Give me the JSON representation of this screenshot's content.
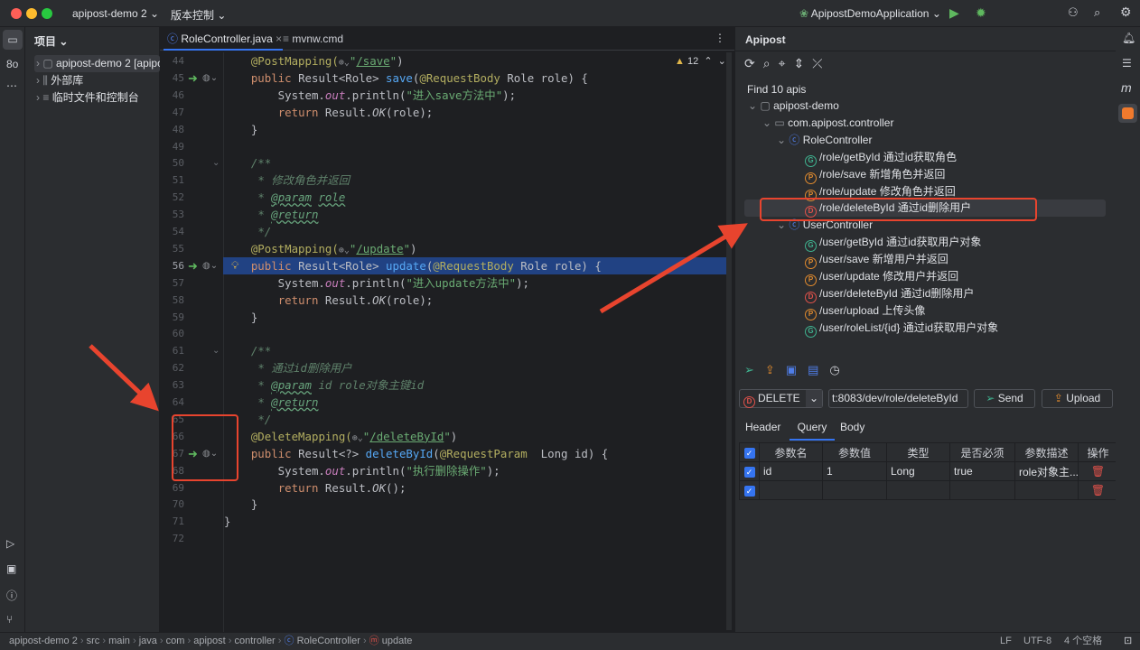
{
  "titlebar": {
    "project": "apipost-demo 2",
    "vcs": "版本控制",
    "run_config": "ApipostDemoApplication"
  },
  "project_panel": {
    "title": "项目",
    "items": [
      {
        "label": "apipost-demo 2 [apipost-demo]",
        "icon": "module-folder-icon"
      },
      {
        "label": "外部库",
        "icon": "library-icon"
      },
      {
        "label": "临时文件和控制台",
        "icon": "scratch-icon"
      }
    ]
  },
  "editor": {
    "tabs": [
      {
        "label": "RoleController.java",
        "active": true
      },
      {
        "label": "mvnw.cmd",
        "active": false
      }
    ],
    "warnings": "12",
    "current_line": 56,
    "lines": [
      {
        "n": 44,
        "t": [
          [
            "    "
          ],
          [
            "@PostMapping(",
            "ann"
          ],
          [
            "⊕⌄",
            "glob"
          ],
          [
            "\"",
            "str"
          ],
          [
            "/save",
            "lnk"
          ],
          [
            "\"",
            "str"
          ],
          [
            ")"
          ]
        ]
      },
      {
        "n": 45,
        "g": true,
        "t": [
          [
            "    "
          ],
          [
            "public ",
            "kw"
          ],
          [
            "Result<Role> "
          ],
          [
            "save",
            "fn"
          ],
          [
            "("
          ],
          [
            "@RequestBody",
            "ann"
          ],
          [
            " Role role) {"
          ]
        ]
      },
      {
        "n": 46,
        "t": [
          [
            "        System."
          ],
          [
            "out",
            "fld"
          ],
          [
            ".println("
          ],
          [
            "\"进入save方法中\"",
            "str"
          ],
          [
            ");"
          ]
        ]
      },
      {
        "n": 47,
        "t": [
          [
            "        "
          ],
          [
            "return ",
            "kw"
          ],
          [
            "Result."
          ],
          [
            "OK",
            "it"
          ],
          [
            "(role);"
          ]
        ]
      },
      {
        "n": 48,
        "t": [
          [
            "    }"
          ]
        ]
      },
      {
        "n": 49,
        "t": []
      },
      {
        "n": 50,
        "f": true,
        "t": [
          [
            "    "
          ],
          [
            "/**",
            "doc"
          ]
        ]
      },
      {
        "n": 51,
        "t": [
          [
            "     "
          ],
          [
            "* 修改角色并返回",
            "doc"
          ]
        ]
      },
      {
        "n": 52,
        "t": [
          [
            "     "
          ],
          [
            "* ",
            "doc"
          ],
          [
            "@param",
            "doctag"
          ],
          [
            " ",
            "doc"
          ],
          [
            "role",
            "doctag"
          ]
        ]
      },
      {
        "n": 53,
        "t": [
          [
            "     "
          ],
          [
            "* ",
            "doc"
          ],
          [
            "@return",
            "doctag"
          ]
        ]
      },
      {
        "n": 54,
        "t": [
          [
            "     "
          ],
          [
            "*/",
            "doc"
          ]
        ]
      },
      {
        "n": 55,
        "t": [
          [
            "    "
          ],
          [
            "@PostMapping(",
            "ann"
          ],
          [
            "⊕⌄",
            "glob"
          ],
          [
            "\"",
            "str"
          ],
          [
            "/update",
            "lnk"
          ],
          [
            "\"",
            "str"
          ],
          [
            ")"
          ]
        ]
      },
      {
        "n": 56,
        "g": true,
        "t": [
          [
            "    "
          ],
          [
            "public ",
            "kw"
          ],
          [
            "Result<Role> "
          ],
          [
            "update",
            "fn"
          ],
          [
            "("
          ],
          [
            "@RequestBody",
            "ann"
          ],
          [
            " Role role) {"
          ]
        ]
      },
      {
        "n": 57,
        "t": [
          [
            "        System."
          ],
          [
            "out",
            "fld"
          ],
          [
            ".println("
          ],
          [
            "\"进入update方法中\"",
            "str"
          ],
          [
            ");"
          ]
        ]
      },
      {
        "n": 58,
        "t": [
          [
            "        "
          ],
          [
            "return ",
            "kw"
          ],
          [
            "Result."
          ],
          [
            "OK",
            "it"
          ],
          [
            "(role);"
          ]
        ]
      },
      {
        "n": 59,
        "t": [
          [
            "    }"
          ]
        ]
      },
      {
        "n": 60,
        "t": []
      },
      {
        "n": 61,
        "f": true,
        "t": [
          [
            "    "
          ],
          [
            "/**",
            "doc"
          ]
        ]
      },
      {
        "n": 62,
        "t": [
          [
            "     "
          ],
          [
            "* 通过id删除用户",
            "doc"
          ]
        ]
      },
      {
        "n": 63,
        "t": [
          [
            "     "
          ],
          [
            "* ",
            "doc"
          ],
          [
            "@param",
            "doctag"
          ],
          [
            " id ",
            "doc"
          ],
          [
            "role对象主键id",
            "doc"
          ]
        ]
      },
      {
        "n": 64,
        "t": [
          [
            "     "
          ],
          [
            "* ",
            "doc"
          ],
          [
            "@return",
            "doctag"
          ]
        ]
      },
      {
        "n": 65,
        "t": [
          [
            "     "
          ],
          [
            "*/",
            "doc"
          ]
        ]
      },
      {
        "n": 66,
        "t": [
          [
            "    "
          ],
          [
            "@DeleteMapping(",
            "ann"
          ],
          [
            "⊕⌄",
            "glob"
          ],
          [
            "\"",
            "str"
          ],
          [
            "/deleteById",
            "lnk"
          ],
          [
            "\"",
            "str"
          ],
          [
            ")"
          ]
        ]
      },
      {
        "n": 67,
        "g": true,
        "t": [
          [
            "    "
          ],
          [
            "public ",
            "kw"
          ],
          [
            "Result<?> "
          ],
          [
            "deleteById",
            "fn"
          ],
          [
            "("
          ],
          [
            "@RequestParam",
            "ann"
          ],
          [
            "  Long id) {"
          ]
        ]
      },
      {
        "n": 68,
        "t": [
          [
            "        System."
          ],
          [
            "out",
            "fld"
          ],
          [
            ".println("
          ],
          [
            "\"执行删除操作\"",
            "str"
          ],
          [
            ");"
          ]
        ]
      },
      {
        "n": 69,
        "t": [
          [
            "        "
          ],
          [
            "return ",
            "kw"
          ],
          [
            "Result."
          ],
          [
            "OK",
            "it"
          ],
          [
            "();"
          ]
        ]
      },
      {
        "n": 70,
        "t": [
          [
            "    }"
          ]
        ]
      },
      {
        "n": 71,
        "t": [
          [
            "}"
          ]
        ]
      },
      {
        "n": 72,
        "t": []
      }
    ]
  },
  "apipost": {
    "title": "Apipost",
    "find_text": "Find 10 apis",
    "tree": [
      {
        "label": "apipost-demo",
        "level": 0,
        "kind": "module"
      },
      {
        "label": "com.apipost.controller",
        "level": 1,
        "kind": "package"
      },
      {
        "label": "RoleController",
        "level": 2,
        "kind": "class"
      },
      {
        "path": "/role/getById",
        "desc": "通过id获取角色",
        "method": "G"
      },
      {
        "path": "/role/save",
        "desc": "新增角色并返回",
        "method": "P"
      },
      {
        "path": "/role/update",
        "desc": "修改角色并返回",
        "method": "P"
      },
      {
        "path": "/role/deleteById",
        "desc": "通过id删除用户",
        "method": "D",
        "selected": true
      },
      {
        "label": "UserController",
        "level": 2,
        "kind": "class"
      },
      {
        "path": "/user/getById",
        "desc": "通过id获取用户对象",
        "method": "G"
      },
      {
        "path": "/user/save",
        "desc": "新增用户并返回",
        "method": "P"
      },
      {
        "path": "/user/update",
        "desc": "修改用户并返回",
        "method": "P"
      },
      {
        "path": "/user/deleteById",
        "desc": "通过id删除用户",
        "method": "D"
      },
      {
        "path": "/user/upload",
        "desc": "上传头像",
        "method": "P"
      },
      {
        "path": "/user/roleList/{id}",
        "desc": "通过id获取用户对象",
        "method": "G"
      }
    ],
    "method": "DELETE",
    "url": "t:8083/dev/role/deleteById",
    "send": "Send",
    "upload": "Upload",
    "req_tabs": [
      "Header",
      "Query",
      "Body"
    ],
    "active_req_tab": "Query",
    "columns": [
      "参数名",
      "参数值",
      "类型",
      "是否必须",
      "参数描述",
      "操作"
    ],
    "rows": [
      {
        "checked": true,
        "name": "id",
        "value": "1",
        "type": "Long",
        "required": "true",
        "desc": "role对象主..."
      },
      {
        "checked": true,
        "name": "",
        "value": "",
        "type": "",
        "required": "",
        "desc": ""
      }
    ]
  },
  "colors": {
    "get": "#3fb28f",
    "post": "#e08a2e",
    "delete": "#e0514a",
    "class": "#4f7de8",
    "annotation_red": "#e8442e",
    "selection": "#214283"
  },
  "statusbar": {
    "crumbs": [
      "apipost-demo 2",
      "src",
      "main",
      "java",
      "com",
      "apipost",
      "controller",
      "RoleController",
      "update"
    ],
    "line_sep": "LF",
    "encoding": "UTF-8",
    "indent": "4 个空格"
  }
}
